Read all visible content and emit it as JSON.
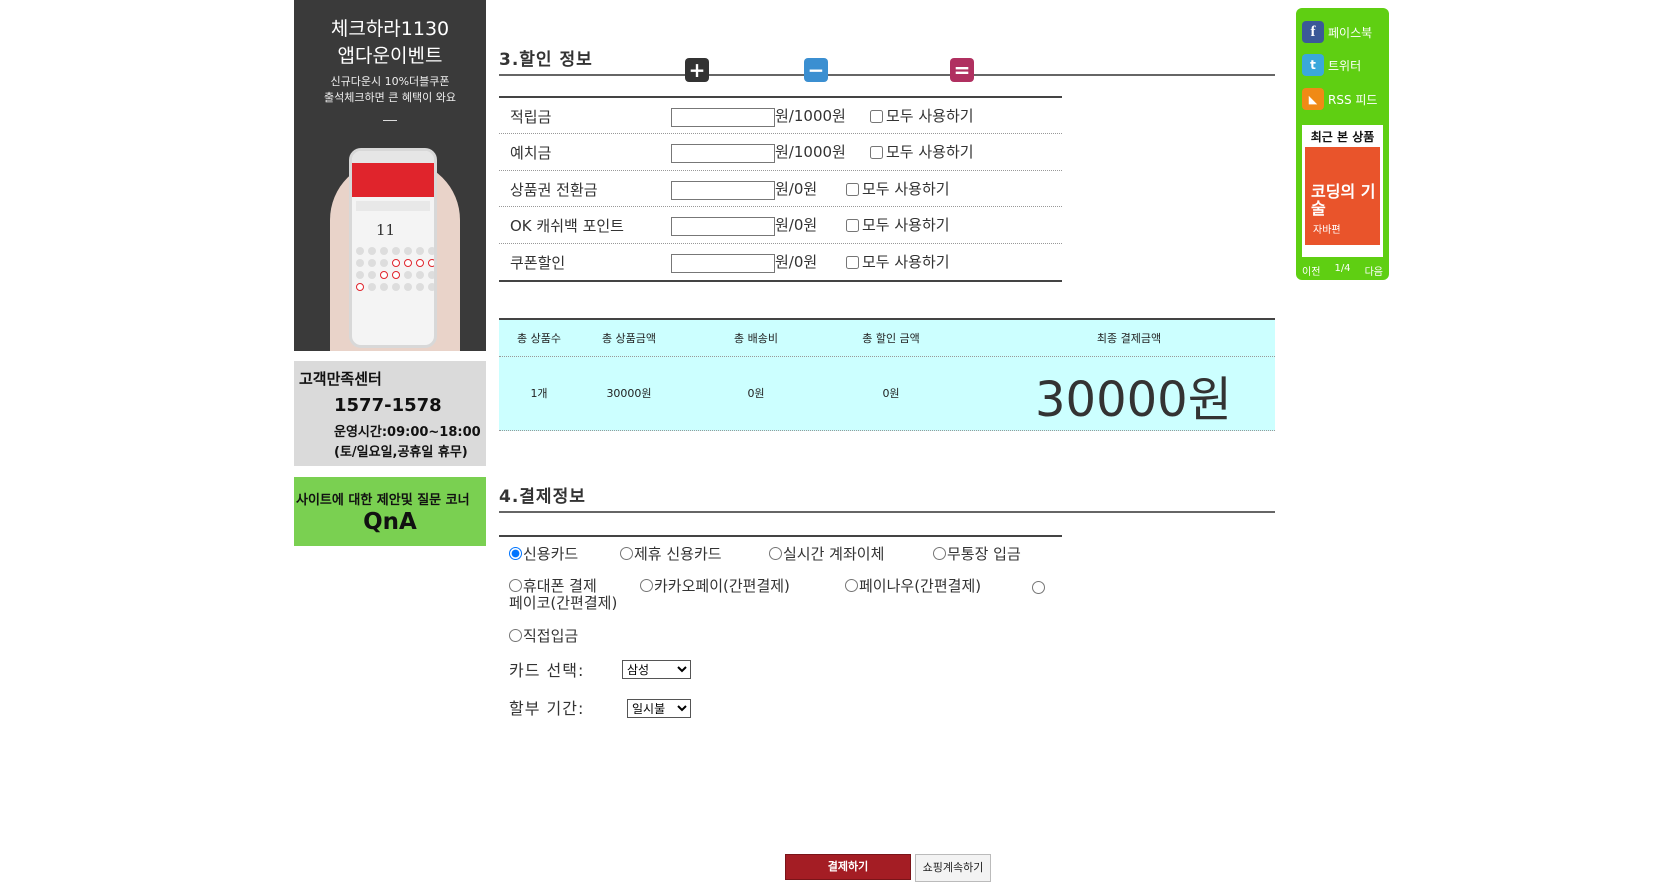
{
  "left": {
    "banner": {
      "title1": "체크하라1130",
      "title2": "앱다운이벤트",
      "sub1": "신규다운시 10%더블쿠폰",
      "sub2": "출석체크하면 큰 혜택이 와요",
      "phone_date": "11"
    },
    "customer_service": {
      "title": "고객만족센터",
      "phone": "1577-1578",
      "hours": "운영시간:09:00~18:00",
      "closed": "(토/일요일,공휴일 휴무)"
    },
    "qna": {
      "title": "사이트에 대한 제안및 질문 코너",
      "big": "QnA"
    }
  },
  "side": {
    "facebook": "페이스북",
    "twitter": "트위터",
    "rss": "RSS 피드",
    "recent_title": "최근 본 상품",
    "book_title": "코딩의 기술",
    "book_name": "자바편",
    "prev": "이전",
    "page": "1/4",
    "next": "다음"
  },
  "discount": {
    "section_title": "3.할인 정보",
    "rows": [
      {
        "label": "적립금",
        "value": "",
        "unit": "원/1000원",
        "check_label": "모두 사용하기"
      },
      {
        "label": "예치금",
        "value": "",
        "unit": "원/1000원",
        "check_label": "모두 사용하기"
      },
      {
        "label": "상품권 전환금",
        "value": "",
        "unit": "원/0원",
        "check_label": "모두 사용하기"
      },
      {
        "label": "OK 캐쉬백 포인트",
        "value": "",
        "unit": "원/0원",
        "check_label": "모두 사용하기"
      },
      {
        "label": "쿠폰할인",
        "value": "",
        "unit": "원/0원",
        "check_label": "모두 사용하기"
      }
    ]
  },
  "summary": {
    "headers": {
      "count": "총 상품수",
      "amount": "총 상품금액",
      "shipping": "총 배송비",
      "discount": "총 할인 금액",
      "final": "최종 결제금액"
    },
    "values": {
      "count": "1개",
      "amount": "30000원",
      "shipping": "0원",
      "discount": "0원",
      "final": "30000원"
    },
    "ops": {
      "plus": "+",
      "minus": "−",
      "equal": "="
    }
  },
  "payment": {
    "section_title": "4.결제정보",
    "methods": {
      "credit": "신용카드",
      "partner": "제휴 신용카드",
      "transfer": "실시간 계좌이체",
      "deposit": "무통장 입금",
      "mobile": "휴대폰 결제",
      "kakao": "카카오페이(간편결제)",
      "paynow": "페이나우(간편결제)",
      "payco": "페이코(간편결제)",
      "direct": "직접입금"
    },
    "selected": "신용카드",
    "card_label": "카드 선택:",
    "card_value": "삼성",
    "install_label": "할부 기간:",
    "install_value": "일시불"
  },
  "buttons": {
    "pay": "결제하기",
    "continue": "쇼핑계속하기"
  }
}
